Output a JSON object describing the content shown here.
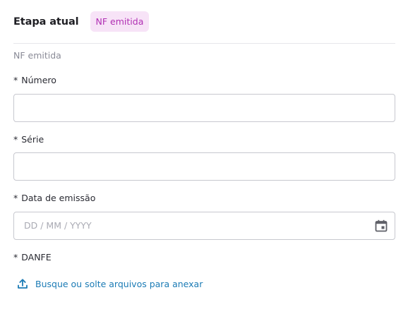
{
  "header": {
    "title": "Etapa atual",
    "badge": "NF emitida"
  },
  "section": {
    "label": "NF emitida"
  },
  "fields": {
    "numero": {
      "required_mark": "*",
      "label": "Número",
      "value": ""
    },
    "serie": {
      "required_mark": "*",
      "label": "Série",
      "value": ""
    },
    "data_emissao": {
      "required_mark": "*",
      "label": "Data de emissão",
      "placeholder": "DD / MM / YYYY"
    },
    "danfe": {
      "required_mark": "*",
      "label": "DANFE"
    }
  },
  "upload": {
    "label": "Busque ou solte arquivos para anexar"
  },
  "icons": {
    "calendar": "calendar-icon",
    "upload": "upload-icon"
  },
  "colors": {
    "badge_bg": "#f7e3f7",
    "badge_text": "#b02fb3",
    "link": "#1b7bb5"
  }
}
